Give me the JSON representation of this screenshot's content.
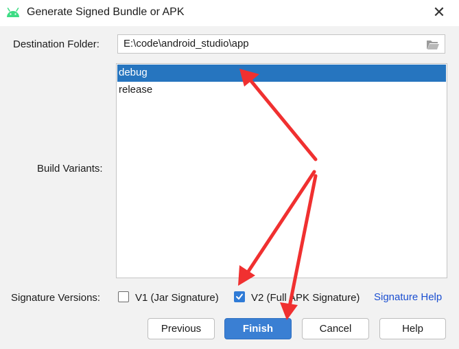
{
  "window": {
    "title": "Generate Signed Bundle or APK",
    "app_icon": "android-icon",
    "close_icon": "close-icon",
    "close_glyph": "✕"
  },
  "destination": {
    "label": "Destination Folder:",
    "value": "E:\\code\\android_studio\\app",
    "browse_icon": "folder-icon"
  },
  "build_variants": {
    "label": "Build Variants:",
    "items": [
      {
        "label": "debug",
        "selected": true
      },
      {
        "label": "release",
        "selected": false
      }
    ]
  },
  "signature": {
    "label": "Signature Versions:",
    "v1": {
      "label": "V1 (Jar Signature)",
      "checked": false
    },
    "v2": {
      "label": "V2 (Full APK Signature)",
      "checked": true
    },
    "help_link": "Signature Help"
  },
  "buttons": {
    "previous": "Previous",
    "finish": "Finish",
    "cancel": "Cancel",
    "help": "Help"
  },
  "colors": {
    "selection": "#2675bf",
    "primary_button": "#3a7fd3",
    "link": "#1b4fd1",
    "annotation_arrow": "#f03030"
  }
}
